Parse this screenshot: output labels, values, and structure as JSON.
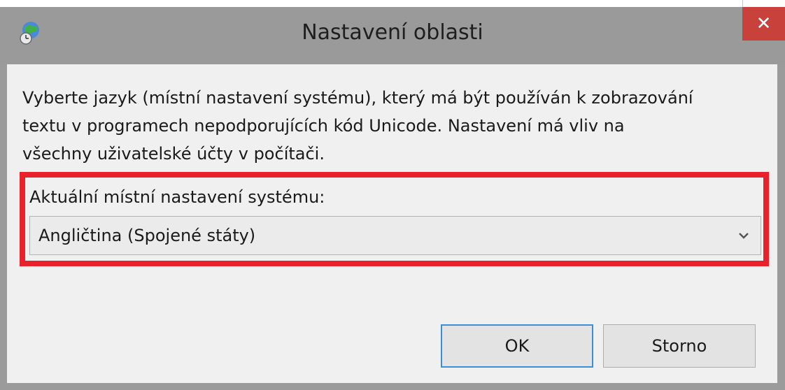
{
  "dialog": {
    "title": "Nastavení oblasti",
    "app_icon": "globe-clock-icon",
    "close_icon": "close-icon",
    "close_glyph": "✕"
  },
  "content": {
    "description": "Vyberte jazyk (místní nastavení systému), který má být používán k zobrazování\ntextu v programech nepodporujících kód Unicode. Nastavení má vliv na\nvšechny uživatelské účty v počítači.",
    "locale_label": "Aktuální místní nastavení systému:",
    "locale_selected": "Angličtina (Spojené státy)",
    "dropdown_icon": "chevron-down-icon"
  },
  "buttons": {
    "ok_label": "OK",
    "cancel_label": "Storno"
  },
  "colors": {
    "close_button": "#c8413a",
    "highlight_border": "#e8212b",
    "titlebar": "#9a9a9a",
    "client_background": "#f0f0f0",
    "ok_focus_border": "#3c8fd6"
  }
}
